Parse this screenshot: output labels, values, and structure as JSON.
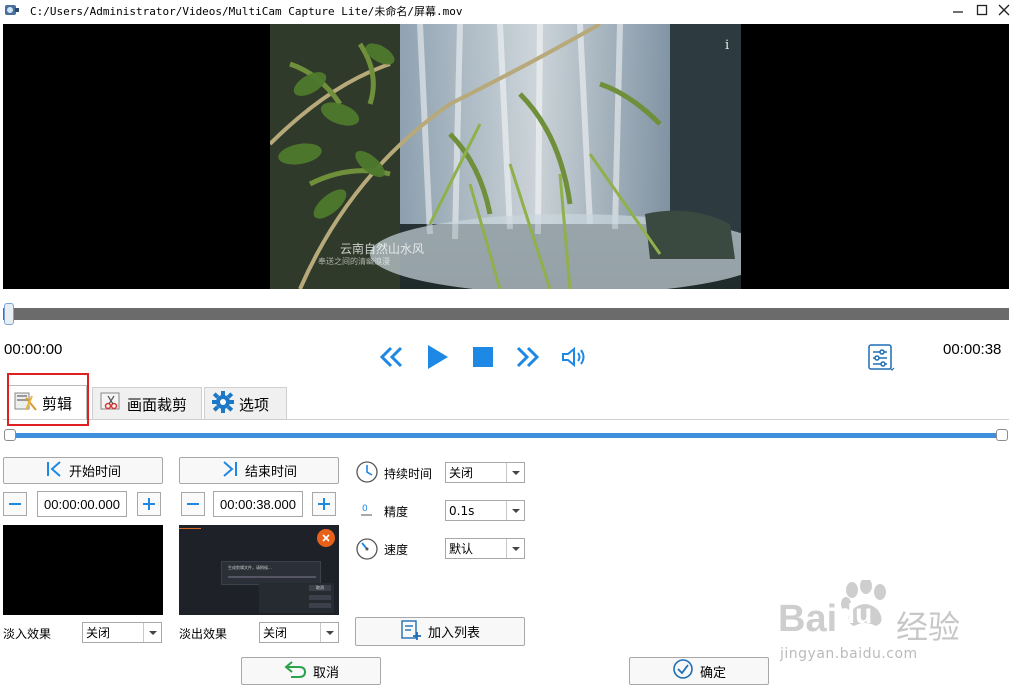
{
  "window": {
    "title": "C:/Users/Administrator/Videos/MultiCam Capture Lite/未命名/屏幕.mov"
  },
  "video": {
    "caption_line1": "云南自然山水风",
    "caption_line2": "奉送之间的清幽浪漫",
    "info_glyph": "i"
  },
  "player": {
    "time_current": "00:00:00",
    "time_total": "00:00:38",
    "progress": 0
  },
  "tabs": [
    {
      "label": "剪辑",
      "icon": "clip-icon",
      "active": true
    },
    {
      "label": "画面裁剪",
      "icon": "crop-scissors-icon",
      "active": false
    },
    {
      "label": "选项",
      "icon": "gear-icon",
      "active": false
    }
  ],
  "trim": {
    "start_button": "开始时间",
    "end_button": "结束时间",
    "start_value": "00:00:00.000",
    "end_value": "00:00:38.000",
    "range_start": 0,
    "range_end": 1
  },
  "fade": {
    "in_label": "淡入效果",
    "in_value": "关闭",
    "out_label": "淡出效果",
    "out_value": "关闭"
  },
  "end_preview": {
    "dialog_text": "生成剪辑文件，请稍候...",
    "btn_label": "取消"
  },
  "options": {
    "duration_label": "持续时间",
    "duration_value": "关闭",
    "precision_label": "精度",
    "precision_value": "0.1s",
    "speed_label": "速度",
    "speed_value": "默认"
  },
  "actions": {
    "add_to_list": "加入列表",
    "cancel": "取消",
    "ok": "确定"
  },
  "watermark": {
    "brand": "Bai",
    "brand_suffix": "du",
    "cn": "经验",
    "url": "jingyan.baidu.com"
  },
  "colors": {
    "accent": "#1e88e5",
    "highlight": "#e02020",
    "range": "#3d8fdc"
  }
}
